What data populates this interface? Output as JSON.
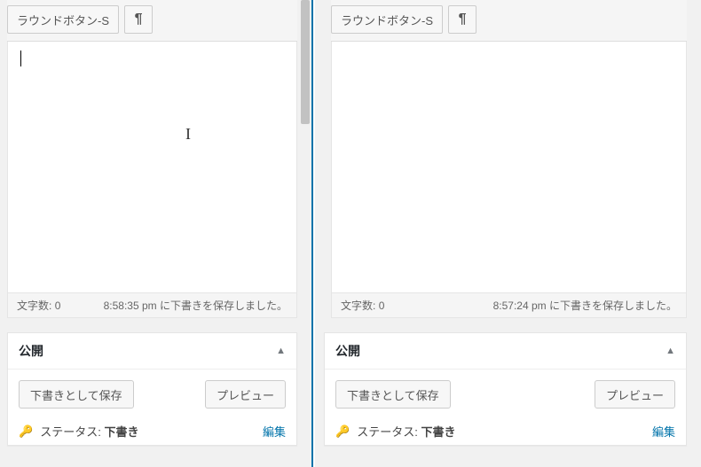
{
  "left": {
    "toolbar": {
      "round_s": "ラウンドボタン-S",
      "pilcrow": "¶"
    },
    "editor": {
      "content": ""
    },
    "statusbar": {
      "wordcount_label": "文字数:",
      "wordcount_value": "0",
      "autosave_time": "8:58:35 pm",
      "autosave_suffix": " に下書きを保存しました。"
    },
    "publish": {
      "heading": "公開",
      "save_draft": "下書きとして保存",
      "preview": "プレビュー",
      "status_label": "ステータス:",
      "status_value": "下書き",
      "edit_label": "編集"
    },
    "icons": {
      "toggle": "▲",
      "key": "🔑"
    }
  },
  "right": {
    "toolbar": {
      "round_s": "ラウンドボタン-S",
      "pilcrow": "¶"
    },
    "editor": {
      "content": ""
    },
    "statusbar": {
      "wordcount_label": "文字数:",
      "wordcount_value": "0",
      "autosave_time": "8:57:24 pm",
      "autosave_suffix": " に下書きを保存しました。"
    },
    "publish": {
      "heading": "公開",
      "save_draft": "下書きとして保存",
      "preview": "プレビュー",
      "status_label": "ステータス:",
      "status_value": "下書き",
      "edit_label": "編集"
    },
    "icons": {
      "toggle": "▲",
      "key": "🔑"
    }
  }
}
